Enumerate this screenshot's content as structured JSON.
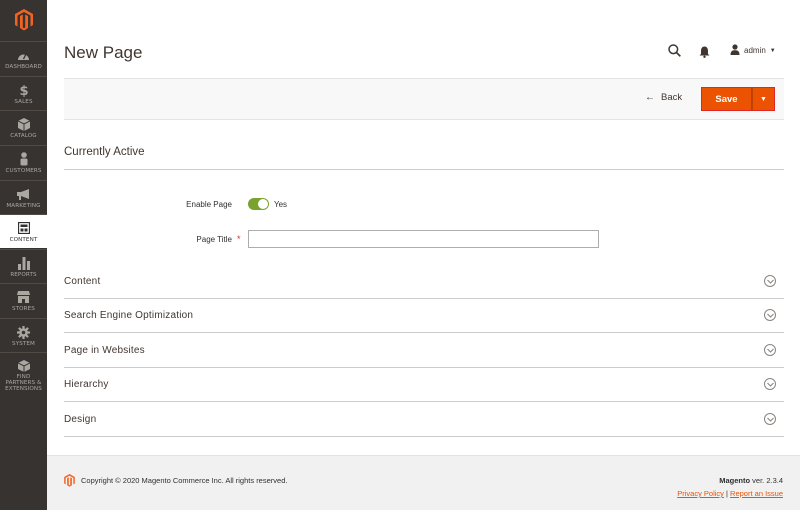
{
  "sidebar": {
    "items": [
      {
        "label": "DASHBOARD",
        "icon": "dashboard-icon"
      },
      {
        "label": "SALES",
        "icon": "dollar-icon"
      },
      {
        "label": "CATALOG",
        "icon": "cube-icon"
      },
      {
        "label": "CUSTOMERS",
        "icon": "person-icon"
      },
      {
        "label": "MARKETING",
        "icon": "megaphone-icon"
      },
      {
        "label": "CONTENT",
        "icon": "layout-icon"
      },
      {
        "label": "REPORTS",
        "icon": "bar-chart-icon"
      },
      {
        "label": "STORES",
        "icon": "storefront-icon"
      },
      {
        "label": "SYSTEM",
        "icon": "gear-icon"
      },
      {
        "label": "FIND PARTNERS & EXTENSIONS",
        "icon": "partners-icon"
      }
    ],
    "active": "CONTENT"
  },
  "header": {
    "title": "New Page",
    "user": "admin"
  },
  "actions": {
    "back_label": "Back",
    "save_label": "Save"
  },
  "form": {
    "section_title": "Currently Active",
    "enable_label": "Enable Page",
    "enable_value": "Yes",
    "title_label": "Page Title",
    "title_required": "*",
    "title_value": ""
  },
  "sections": [
    {
      "title": "Content"
    },
    {
      "title": "Search Engine Optimization"
    },
    {
      "title": "Page in Websites"
    },
    {
      "title": "Hierarchy"
    },
    {
      "title": "Design"
    }
  ],
  "footer": {
    "copyright": "Copyright © 2020 Magento Commerce Inc. All rights reserved.",
    "brand": "Magento",
    "version": " ver. 2.3.4",
    "privacy": "Privacy Policy",
    "separator": " | ",
    "report": "Report an Issue"
  },
  "colors": {
    "accent": "#eb5202",
    "sidebar": "#373330",
    "toggle_on": "#79a22e"
  }
}
